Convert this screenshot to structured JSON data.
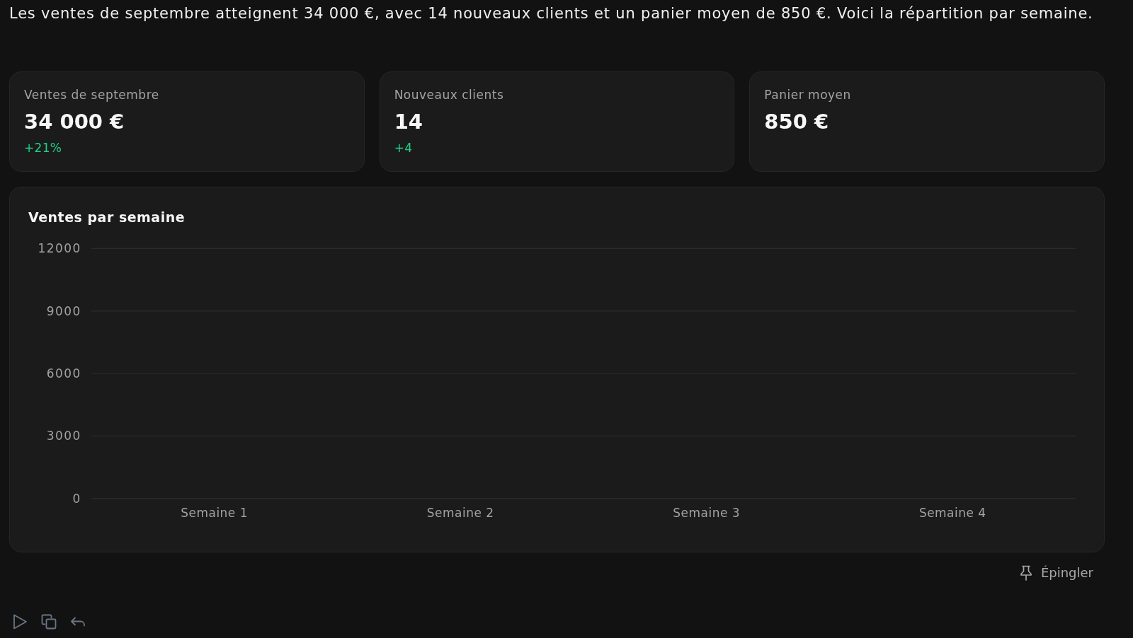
{
  "message": {
    "text": "Les ventes de septembre atteignent 34 000 €, avec 14 nouveaux clients et un panier moyen de 850 €. Voici la répartition par semaine."
  },
  "stats": [
    {
      "label": "Ventes de septembre",
      "value": "34 000 €",
      "change": "+21%"
    },
    {
      "label": "Nouveaux clients",
      "value": "14",
      "change": "+4"
    },
    {
      "label": "Panier moyen",
      "value": "850 €"
    }
  ],
  "chart": {
    "chart_data": {
      "type": "bar",
      "title": "Ventes par semaine",
      "categories": [
        "Semaine 1",
        "Semaine 2",
        "Semaine 3",
        "Semaine 4"
      ],
      "ylim": [
        0,
        12000
      ],
      "yticks": [
        0,
        3000,
        6000,
        9000,
        12000
      ],
      "grid": true
    }
  },
  "pin_button": {
    "label": "Épingler"
  }
}
